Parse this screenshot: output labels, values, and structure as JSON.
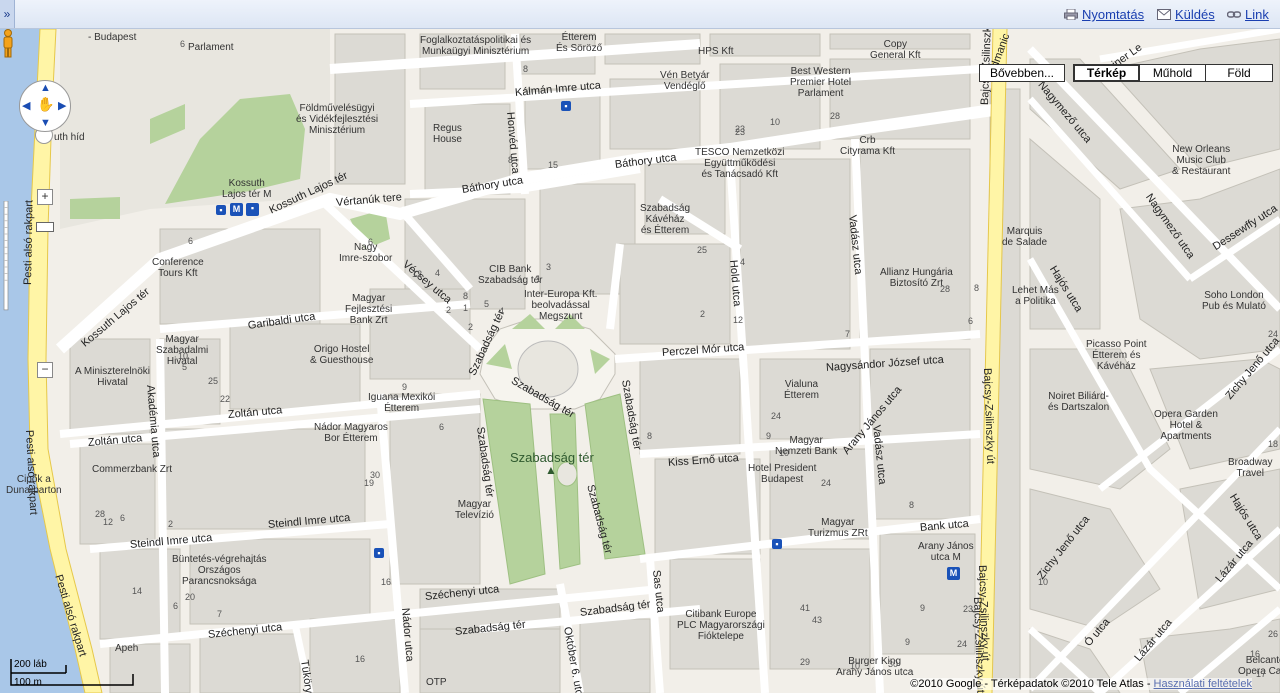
{
  "topbar": {
    "print": "Nyomtatás",
    "send": "Küldés",
    "link": "Link",
    "collapse_glyph": "»"
  },
  "map_types": {
    "more": "Bővebben...",
    "map": "Térkép",
    "satellite": "Műhold",
    "earth": "Föld",
    "active": "Térkép"
  },
  "scale": {
    "feet": "200 láb",
    "meters": "100 m"
  },
  "copyright": {
    "text": "©2010 Google - Térképadatok ©2010 Tele Atlas - ",
    "terms": "Használati feltételek"
  },
  "colors": {
    "water": "#a9c7e8",
    "park": "#b5d29c",
    "road_major": "#fff5a6",
    "road": "#ffffff",
    "land": "#f2efe9",
    "building": "#dcdad4"
  },
  "labels": {
    "szabadsag_ter": "Szabadság tér",
    "budapest": "- Budapest",
    "parlament": "Parlament",
    "foglalkoztatas": "Foglalkoztatáspolitikai és\nMunkaügyi Minisztérium",
    "ertem_sorozo": "Étterem\nÉs Söröző",
    "hps": "HPS Kft",
    "copy_general": "Copy\nGeneral Kft",
    "best_western": "Best Western\nPremier Hotel\nParlament",
    "ven_betyar": "Vén Betyár\nVendéglő",
    "foldmuveles": "Földművelésügyi\nés Vidékfejlesztési\nMinisztérium",
    "regus": "Regus\nHouse",
    "tesco": "TESCO Nemzetközi\nEgyüttműködési\nés Tanácsadó Kft",
    "crb": "Crb\nCityrama Kft",
    "new_orleans": "New Orleans\nMusic Club\n& Restaurant",
    "kossuth_metro": "Kossuth\nLajos tér M",
    "nagy_imre": "Nagy\nImre-szobor",
    "szabadsag_kavehaz": "Szabadság\nKávéház\nés Étterem",
    "conference": "Conference\nTours Kft",
    "cib": "CIB Bank\nSzabadság tér",
    "marquis": "Marquis\nde Salade",
    "allianz": "Allianz Hungária\nBiztosító Zrt",
    "lehet_mas": "Lehet Más\na Politika",
    "soho": "Soho London\nPub és Mulató",
    "inter_europa": "Inter-Europa Kft.\nbeolvadással\nMegszunt",
    "magyar_fejleszt": "Magyar\nFejlesztési\nBank Zrt",
    "magyar_szabadalmi": "Magyar\nSzabadalmi\nHivatal",
    "origo": "Origo Hostel\n& Guesthouse",
    "miniszterelnoki": "A Miniszterelnöki\nHivatal",
    "picasso": "Picasso Point\nÉtterem és\nKávéház",
    "noiret": "Noiret Biliárd-\nés Dartszalon",
    "vialuna": "Vialuna\nÉtterem",
    "iguana": "Iguana Mexikói\nÉtterem",
    "nador": "Nádor Magyaros\nBor Étterem",
    "opera_garden": "Opera Garden\nHotel &\nApartments",
    "magyar_nemzeti": "Magyar\nNemzeti Bank",
    "hotel_president": "Hotel President\nBudapest",
    "broadway": "Broadway\nTravel",
    "commerzbank": "Commerzbank Zrt",
    "cipok": "Cipők a\nDuna-parton",
    "magyar_televizio": "Magyar\nTelevízió",
    "magyar_turizmus": "Magyar\nTurizmus ZRt",
    "arany_janos": "Arany János\nutca M",
    "buntetes": "Büntetés-végrehajtás\nOrszágos\nParancsnoksága",
    "citibank": "Citibank Europe\nPLC Magyarországi\nFióktelepe",
    "burger_king": "Burger King\nArany János utca",
    "belcanto": "Belcanto\nOpera Caffé",
    "apeh": "Apeh",
    "otp": "OTP",
    "kossuth_hid": "uth híd"
  },
  "streets": {
    "pesti_also_rakpart": "Pesti alsó rakpart",
    "kossuth_lajos_ter": "Kossuth Lajos tér",
    "kossuth_lajos_ter2": "Kossuth Lajos tér",
    "vertanuk_tere": "Vértanúk tere",
    "bathory1": "Báthory utca",
    "bathory2": "Báthory utca",
    "kalman_imre": "Kálmán Imre utca",
    "honved": "Honvéd utca",
    "garibaldi": "Garibaldi utca",
    "vecsey": "Vécsey utca",
    "szabadsag_ter_nw": "Szabadság tér",
    "szabadsag_ter_c": "Szabadság tér",
    "szabadsag_ter_e": "Szabadság tér",
    "szabadsag_ter_w": "Szabadság tér",
    "szabadsag_ter_se": "Szabadság tér",
    "szabadsag_ter_s1": "Szabadság tér",
    "szabadsag_ter_s2": "Szabadság tér",
    "akademia": "Akadémia utca",
    "zoltan1": "Zoltán utca",
    "zoltan2": "Zoltán utca",
    "perczel": "Perczel Mór utca",
    "nagysandor": "Nagysándor József utca",
    "hold": "Hold utca",
    "vadasz1": "Vadász utca",
    "vadasz2": "Vadász utca",
    "kiss_erno": "Kiss Ernő utca",
    "steindl1": "Steindl Imre utca",
    "steindl2": "Steindl Imre utca",
    "nador": "Nádor utca",
    "szechenyi1": "Széchenyi utca",
    "szechenyi2": "Széchenyi utca",
    "sas": "Sas utca",
    "oktober6": "Október 6. utca",
    "tukory": "Tüköry utca",
    "bank": "Bank utca",
    "bajcsy1": "Bajcsy-Zsilinszky út",
    "bajcsy2": "Bajcsy-Zsilinszky út",
    "bajcsy3": "Bajcsy-Zsilinszky út",
    "bajcsy4": "Bajcsy-Zsilinszky út",
    "nagymezo1": "Nagymező utca",
    "nagymezo2": "Nagymező utca",
    "weiner": "Weiner Le",
    "podmaniczky": "Podmanic",
    "hajos1": "Hajós utca",
    "hajos2": "Hajós utca",
    "dessewffy": "Dessewffy utca",
    "zichy1": "Zichy Jenő utca",
    "zichy2": "Zichy Jenő utca",
    "arany_janos_s": "Arany János utca",
    "o_utca": "Ó utca",
    "lazar": "Lázár utca",
    "lazar2": "Lázár utca"
  },
  "house_numbers": [
    "6",
    "23",
    "10",
    "8",
    "15",
    "8",
    "23",
    "28",
    "6",
    "6",
    "4",
    "12",
    "2",
    "1",
    "8",
    "5",
    "4",
    "2",
    "1",
    "3",
    "25",
    "4",
    "2",
    "12",
    "28",
    "6",
    "7",
    "8",
    "5",
    "25",
    "22",
    "10",
    "9",
    "6",
    "30",
    "8",
    "24",
    "9",
    "10",
    "24",
    "8",
    "19",
    "28",
    "12",
    "6",
    "2",
    "14",
    "6",
    "7",
    "20",
    "16",
    "16",
    "29",
    "41",
    "43",
    "30",
    "10",
    "9",
    "9",
    "24",
    "10",
    "17",
    "26",
    "18",
    "24",
    "23",
    "16"
  ],
  "icons": [
    "print-icon",
    "mail-icon",
    "link-icon",
    "pan-hand-icon",
    "pegman-icon",
    "zoom-in-icon",
    "zoom-out-icon",
    "metro-icon",
    "bus-icon",
    "restaurant-icon",
    "bank-icon",
    "tree-icon"
  ]
}
